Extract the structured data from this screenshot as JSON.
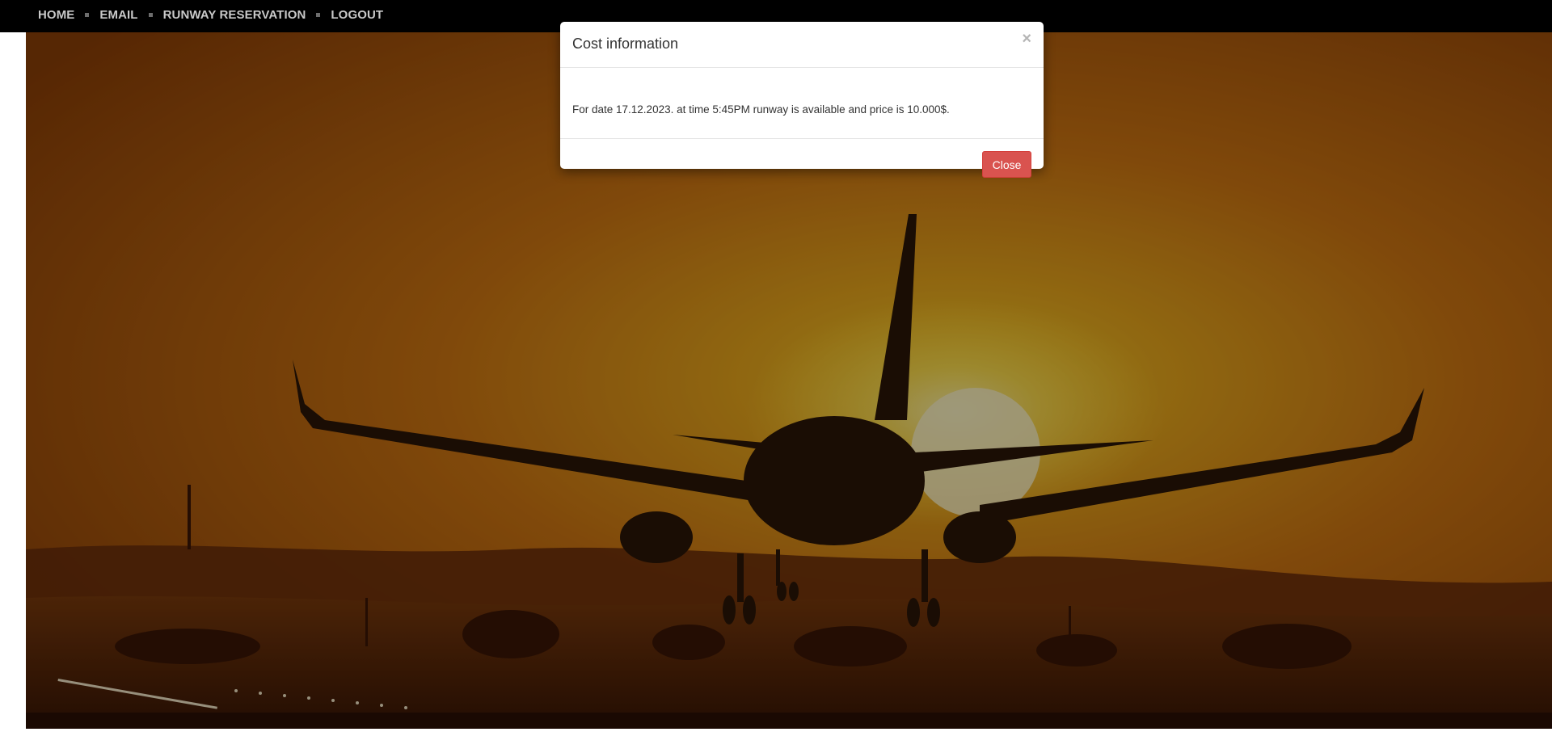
{
  "navbar": {
    "items": [
      {
        "label": "HOME"
      },
      {
        "label": "EMAIL"
      },
      {
        "label": "RUNWAY RESERVATION"
      },
      {
        "label": "LOGOUT"
      }
    ]
  },
  "modal": {
    "title": "Cost information",
    "close_symbol": "×",
    "message": "For date 17.12.2023. at time 5:45PM runway is available and price is 10.000$.",
    "close_button_label": "Close"
  },
  "colors": {
    "navbar_bg": "#000000",
    "danger_button": "#d9534f",
    "sky_orange": "#c76a10",
    "sun_glow": "#f2c21a"
  },
  "icons": {
    "modal_close": "close-icon",
    "nav_separator": "square-bullet"
  }
}
